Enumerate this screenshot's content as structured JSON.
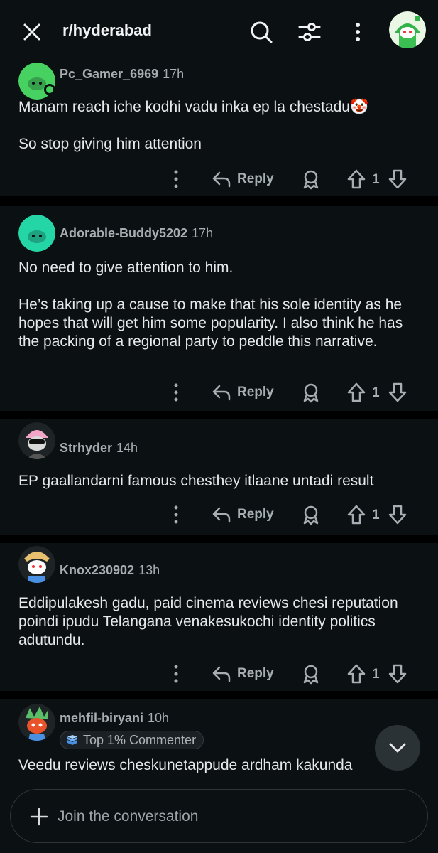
{
  "header": {
    "title": "r/hyderabad",
    "icons": [
      "close-icon",
      "search-icon",
      "filter-icon",
      "more-vertical-icon"
    ]
  },
  "action_labels": {
    "reply": "Reply"
  },
  "comments": [
    {
      "username": "Pc_Gamer_6969",
      "time": "17h",
      "body": [
        "Manam reach iche kodhi vadu inka ep la chestadu🤡",
        "So stop giving him attention"
      ],
      "votes": "1",
      "avatar_color": "#46d160",
      "online": true
    },
    {
      "username": "Adorable-Buddy5202",
      "time": "17h",
      "body": [
        "No need to give attention to him.",
        "He’s taking up a cause to make that his sole identity as he hopes that will get him some popularity. I also think he has the packing of a regional party to peddle this narrative."
      ],
      "votes": "1",
      "avatar_color": "#24d5a6"
    },
    {
      "username": "Strhyder",
      "time": "14h",
      "body": [
        "EP gaallandarni famous chesthey itlaane untadi result"
      ],
      "votes": "1",
      "avatar_color": "#e8a0c0"
    },
    {
      "username": "Knox230902",
      "time": "13h",
      "body": [
        "Eddipulakesh gadu, paid cinema reviews chesi reputation poindi ipudu Telangana venakesukochi identity politics adutundu."
      ],
      "votes": "1",
      "avatar_color": "#4a90e2"
    },
    {
      "username": "mehfil-biryani",
      "time": "10h",
      "badge": "Top 1% Commenter",
      "body": [
        "Veedu reviews cheskunetappude ardham kakunda"
      ],
      "avatar_color": "#e8532a"
    }
  ],
  "composer": {
    "placeholder": "Join the conversation"
  },
  "colors": {
    "background": "#000000",
    "card": "#0b1012",
    "text": "#e6e8ea",
    "muted": "#a7aeb3"
  }
}
